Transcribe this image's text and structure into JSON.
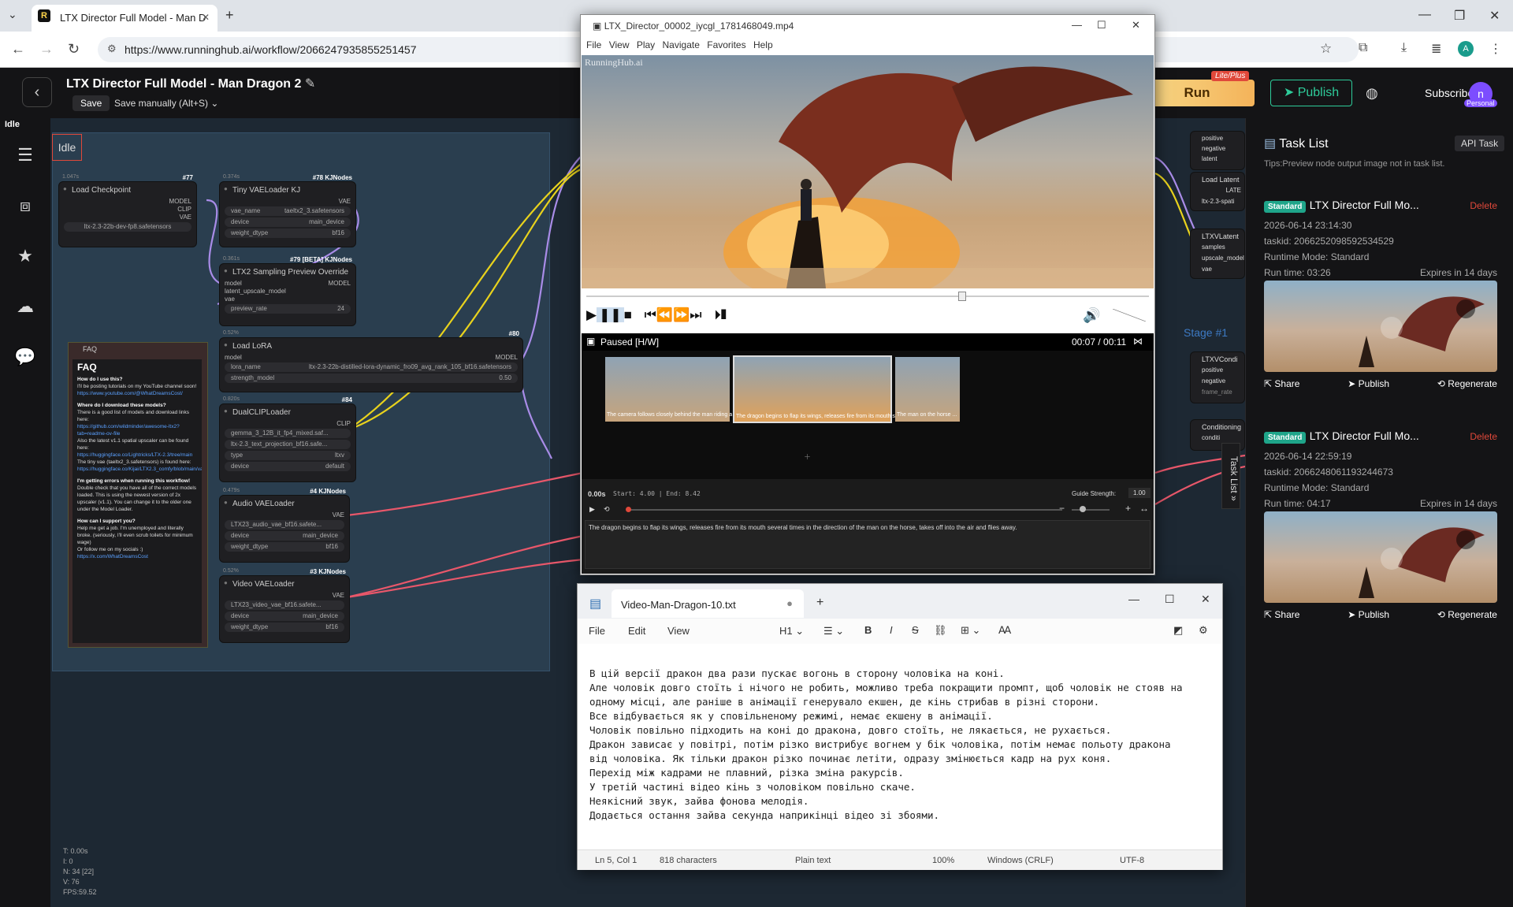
{
  "browser": {
    "tab_title": "LTX Director Full Model - Man D",
    "url": "https://www.runninghub.ai/workflow/2066247935855251457"
  },
  "app": {
    "title": "LTX Director Full Model - Man Dragon 2",
    "save_label": "Save",
    "save_manually": "Save manually (Alt+S)",
    "run_label": "Run",
    "lite_badge": "Lite/Plus",
    "publish_label": "Publish",
    "subscribe_label": "Subscribe",
    "avatar_letter": "n",
    "personal_badge": "Personal",
    "idle_top": "Idle",
    "idle_box": "Idle"
  },
  "stats": [
    "T: 0.00s",
    "I: 0",
    "N: 34 [22]",
    "V: 76",
    "FPS:59.52"
  ],
  "nodes": {
    "load_checkpoint": {
      "tag": "#77",
      "latency": "1.047s",
      "title": "Load Checkpoint",
      "out1": "MODEL",
      "out2": "CLIP",
      "out3": "VAE",
      "ckpt": "ltx-2.3-22b-dev-fp8.safetensors"
    },
    "tiny_vae": {
      "tag": "#78 KJNodes",
      "latency": "0.374s",
      "title": "Tiny VAELoader KJ",
      "out": "VAE",
      "r1k": "vae_name",
      "r1v": "taeltx2_3.safetensors",
      "r2k": "device",
      "r2v": "main_device",
      "r3k": "weight_dtype",
      "r3v": "bf16"
    },
    "ltx2_preview": {
      "tag": "#79 [BETA] KJNodes",
      "latency": "0.361s",
      "title": "LTX2 Sampling Preview Override",
      "in1": "model",
      "in2": "latent_upscale_model",
      "in3": "vae",
      "out": "MODEL",
      "r1k": "preview_rate",
      "r1v": "24"
    },
    "load_lora": {
      "tag": "#80",
      "latency": "0.52%",
      "title": "Load LoRA",
      "in1": "model",
      "out": "MODEL",
      "r1k": "lora_name",
      "r1v": "ltx-2.3-22b-distilled-lora-dynamic_fro09_avg_rank_105_bf16.safetensors",
      "r2k": "strength_model",
      "r2v": "0.50"
    },
    "dual_clip": {
      "tag": "#84",
      "latency": "0.820s",
      "title": "DualCLIPLoader",
      "out": "CLIP",
      "r1v": "gemma_3_12B_it_fp4_mixed.saf...",
      "r2v": "ltx-2.3_text_projection_bf16.safe...",
      "r3k": "type",
      "r3v": "ltxv",
      "r4k": "device",
      "r4v": "default"
    },
    "audio_vae": {
      "tag": "#4 KJNodes",
      "latency": "0.479s",
      "title": "Audio VAELoader",
      "out": "VAE",
      "r1v": "LTX23_audio_vae_bf16.safete...",
      "r2k": "device",
      "r2v": "main_device",
      "r3k": "weight_dtype",
      "r3v": "bf16"
    },
    "video_vae": {
      "tag": "#3 KJNodes",
      "latency": "0.52%",
      "title": "Video VAELoader",
      "out": "VAE",
      "r1v": "LTX23_video_vae_bf16.safete...",
      "r2k": "device",
      "r2v": "main_device",
      "r3k": "weight_dtype",
      "r3v": "bf16"
    }
  },
  "faq": {
    "header": "FAQ",
    "title": "FAQ",
    "q1": "How do I use this?",
    "a1": "I'll be posting tutorials on my YouTube channel soon!",
    "l1": "https://www.youtube.com/@WhatDreamsCost/",
    "q2": "Where do I download these models?",
    "a2": "There is a good list of models and download links here:",
    "l2": "https://github.com/wildminder/awesome-ltx2?tab=readme-ov-file",
    "a3": "Also the latest v1.1 spatial upscaler can be found here:",
    "l3": "https://huggingface.co/Lightricks/LTX-2.3/tree/main",
    "a4": "The tiny vae (taeltx2_3.safetensors) is found here:",
    "l4": "https://huggingface.co/Kijai/LTX2.3_comfy/blob/main/vae/taeltx2_3.safetensors",
    "q3": "I'm getting errors when running this workflow!",
    "a5": "Double check that you have all of the correct models loaded. This is using the newest version of 2x upscaler (v1.1). You can change it to the older one under the Model Loader.",
    "q4": "How can I support you?",
    "a6": "Help me get a job. I'm unemployed and literally broke. (seriously, I'll even scrub toilets for minimum wage)",
    "a7": "Or follow me on my socials :)",
    "l5": "https://x.com/WhatDreamsCost"
  },
  "right_strip": {
    "p1": "positive",
    "p2": "negative",
    "p3": "latent",
    "load_latent": "Load Latent",
    "latent_out": "LATE",
    "ltx23": "ltx-2.3-spati",
    "ltxvlatent": "LTXVLatent",
    "s1": "samples",
    "s2": "upscale_model",
    "s3": "vae",
    "stage": "Stage #1",
    "ltxvcond": "LTXVCondi",
    "c1": "positive",
    "c2": "negative",
    "c3": "frame_rate",
    "conditioning": "Conditioning",
    "condi": "conditi",
    "task_list_tab": "Task List"
  },
  "task_panel": {
    "title": "Task List",
    "api_task": "API Task",
    "tips": "Tips:Preview node output image not in task list.",
    "tasks": [
      {
        "badge": "Standard",
        "title": "LTX Director Full Mo...",
        "delete": "Delete",
        "date": "2026-06-14 23:14:30",
        "taskid": "taskid: 2066252098592534529",
        "mode": "Runtime Mode: Standard",
        "runtime": "Run time: 03:26",
        "expires": "Expires in 14 days",
        "share": "Share",
        "publish": "Publish",
        "regenerate": "Regenerate"
      },
      {
        "badge": "Standard",
        "title": "LTX Director Full Mo...",
        "delete": "Delete",
        "date": "2026-06-14 22:59:19",
        "taskid": "taskid: 2066248061193244673",
        "mode": "Runtime Mode: Standard",
        "runtime": "Run time: 04:17",
        "expires": "Expires in 14 days",
        "share": "Share",
        "publish": "Publish",
        "regenerate": "Regenerate"
      }
    ]
  },
  "player": {
    "window_title": "LTX_Director_00002_iycgl_1781468049.mp4",
    "menu": [
      "File",
      "View",
      "Play",
      "Navigate",
      "Favorites",
      "Help"
    ],
    "watermark": "RunningHub.ai",
    "status": "Paused [H/W]",
    "time": "00:07 / 00:11",
    "frames": [
      "The camera follows closely behind the man riding a hors...",
      "The dragon begins to flap its wings, releases fire from its mouth several ...",
      "The man on the horse ..."
    ],
    "timer": "0.00s",
    "start_end": "Start: 4.00 | End: 8.42",
    "guide_label": "Guide Strength:",
    "guide_value": "1.00",
    "prompt": "The dragon begins to flap its wings, releases fire from its mouth several times in the direction of the man on the horse, takes off into the air and flies away."
  },
  "notepad": {
    "tab": "Video-Man-Dragon-10.txt",
    "menu_file": "File",
    "menu_edit": "Edit",
    "menu_view": "View",
    "heading": "H1",
    "lines": [
      "В цій версії дракон два рази пускає вогонь в сторону чоловіка на коні.",
      "Але чоловік довго стоїть і нічого не робить, можливо треба покращити промпт, щоб чоловік не стояв на",
      "одному місці, але раніше в анімації генерувало екшен, де кінь стрибав в різні сторони.",
      "Все відбувається як у сповільненому режимі, немає екшену в анімації.",
      "Чоловік повільно підходить на коні до дракона, довго стоїть, не лякається, не рухається.",
      "Дракон зависає у повітрі, потім різко вистрибує вогнем у бік чоловіка, потім немає польоту дракона",
      "від чоловіка. Як тільки дракон різко починає летіти, одразу змінюється кадр на рух коня.",
      "Перехід між кадрами не плавний, різка зміна ракурсів.",
      "У третій частині відео кінь з чоловіком повільно скаче.",
      "Неякісний звук, зайва фонова мелодія.",
      "Додається остання зайва секунда наприкінці відео зі збоями."
    ],
    "status_pos": "Ln 5, Col 1",
    "status_chars": "818 characters",
    "status_type": "Plain text",
    "status_zoom": "100%",
    "status_eol": "Windows (CRLF)",
    "status_enc": "UTF-8"
  },
  "colors": {
    "accent_green": "#2ecc9a",
    "run_gold": "#f4b35a",
    "delete_red": "#e0483a",
    "wire_red": "#e8576a",
    "wire_yellow": "#e8d21d",
    "wire_purple": "#a98ce8"
  }
}
